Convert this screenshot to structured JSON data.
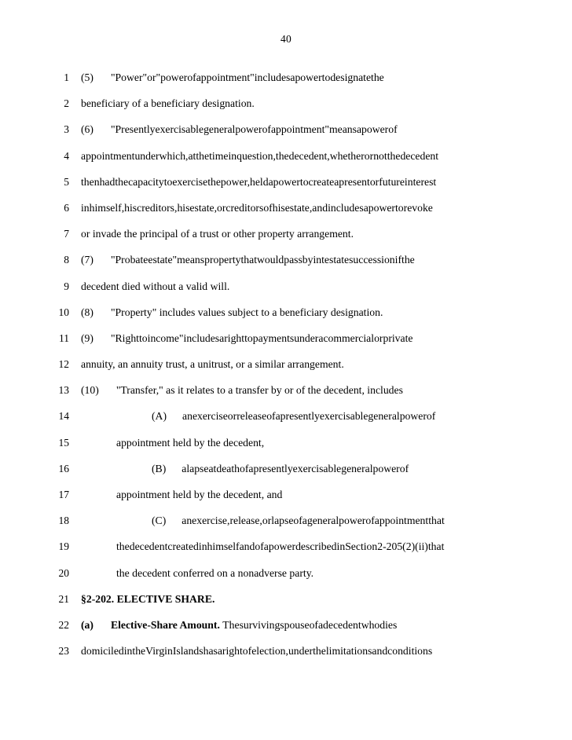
{
  "document": {
    "page_number": "40",
    "section_heading": "§2-202. ELECTIVE SHARE."
  },
  "lines": [
    {
      "number": "1",
      "indent": 0,
      "justified": true,
      "marker": "(5)",
      "text": "\"Power\" or \"power of appointment\" includes a power to designate the"
    },
    {
      "number": "2",
      "indent": 0,
      "justified": false,
      "marker": "",
      "text": "beneficiary of a beneficiary designation."
    },
    {
      "number": "3",
      "indent": 0,
      "justified": true,
      "marker": "(6)",
      "text": "\"Presently exercisable general power of appointment\" means a power of"
    },
    {
      "number": "4",
      "indent": 0,
      "justified": true,
      "marker": "",
      "text": "appointment under which, at the time in question, the decedent, whether or not the decedent"
    },
    {
      "number": "5",
      "indent": 0,
      "justified": true,
      "marker": "",
      "text": "then had the capacity to exercise the power, held a power to create a present or future interest"
    },
    {
      "number": "6",
      "indent": 0,
      "justified": true,
      "marker": "",
      "text": "in himself, his creditors, his estate, or creditors of his estate, and includes a power to revoke"
    },
    {
      "number": "7",
      "indent": 0,
      "justified": false,
      "marker": "",
      "text": "or invade the principal of a trust or other property arrangement."
    },
    {
      "number": "8",
      "indent": 0,
      "justified": true,
      "marker": "(7)",
      "text": "\"Probate estate\" means property that would pass by intestate succession if the"
    },
    {
      "number": "9",
      "indent": 0,
      "justified": false,
      "marker": "",
      "text": "decedent died without a valid will."
    },
    {
      "number": "10",
      "indent": 0,
      "justified": false,
      "marker": "(8)",
      "text": "\"Property\" includes values subject to a beneficiary designation."
    },
    {
      "number": "11",
      "indent": 0,
      "justified": true,
      "marker": "(9)",
      "text": "\"Right to income\" includes a right to payments under a commercial or private"
    },
    {
      "number": "12",
      "indent": 0,
      "justified": false,
      "marker": "",
      "text": "annuity, an annuity trust, a unitrust, or a similar arrangement."
    },
    {
      "number": "13",
      "indent": 0,
      "justified": false,
      "marker": "(10)",
      "text": "\"Transfer,\" as it relates to a transfer by or of the decedent, includes"
    },
    {
      "number": "14",
      "indent": 2,
      "justified": true,
      "marker": "(A)",
      "text": "an exercise or release of a presently exercisable general power of"
    },
    {
      "number": "15",
      "indent": 1,
      "justified": false,
      "marker": "",
      "text": "appointment held by the decedent,"
    },
    {
      "number": "16",
      "indent": 2,
      "justified": true,
      "marker": "(B)",
      "text": "a lapse at death of a presently exercisable general power of"
    },
    {
      "number": "17",
      "indent": 1,
      "justified": false,
      "marker": "",
      "text": "appointment held by the decedent, and"
    },
    {
      "number": "18",
      "indent": 2,
      "justified": true,
      "marker": "(C)",
      "text": "an exercise, release, or lapse of a general power of appointment that"
    },
    {
      "number": "19",
      "indent": 1,
      "justified": true,
      "marker": "",
      "text": "the decedent created in himself and of a power described in Section 2-205(2)(ii) that"
    },
    {
      "number": "20",
      "indent": 1,
      "justified": false,
      "marker": "",
      "text": "the decedent conferred on a nonadverse party."
    },
    {
      "number": "21",
      "indent": 0,
      "justified": false,
      "marker": "",
      "bold_all": true,
      "text": "§2-202. ELECTIVE SHARE."
    },
    {
      "number": "22",
      "indent": 0,
      "justified": true,
      "marker": "(a)",
      "marker_bold": true,
      "lead_bold": "Elective-Share Amount.",
      "text": "The surviving spouse of a decedent who dies"
    },
    {
      "number": "23",
      "indent": 0,
      "justified": true,
      "marker": "",
      "text": "domiciled in the Virgin Islands has a right of election, under the limitations and conditions"
    }
  ]
}
